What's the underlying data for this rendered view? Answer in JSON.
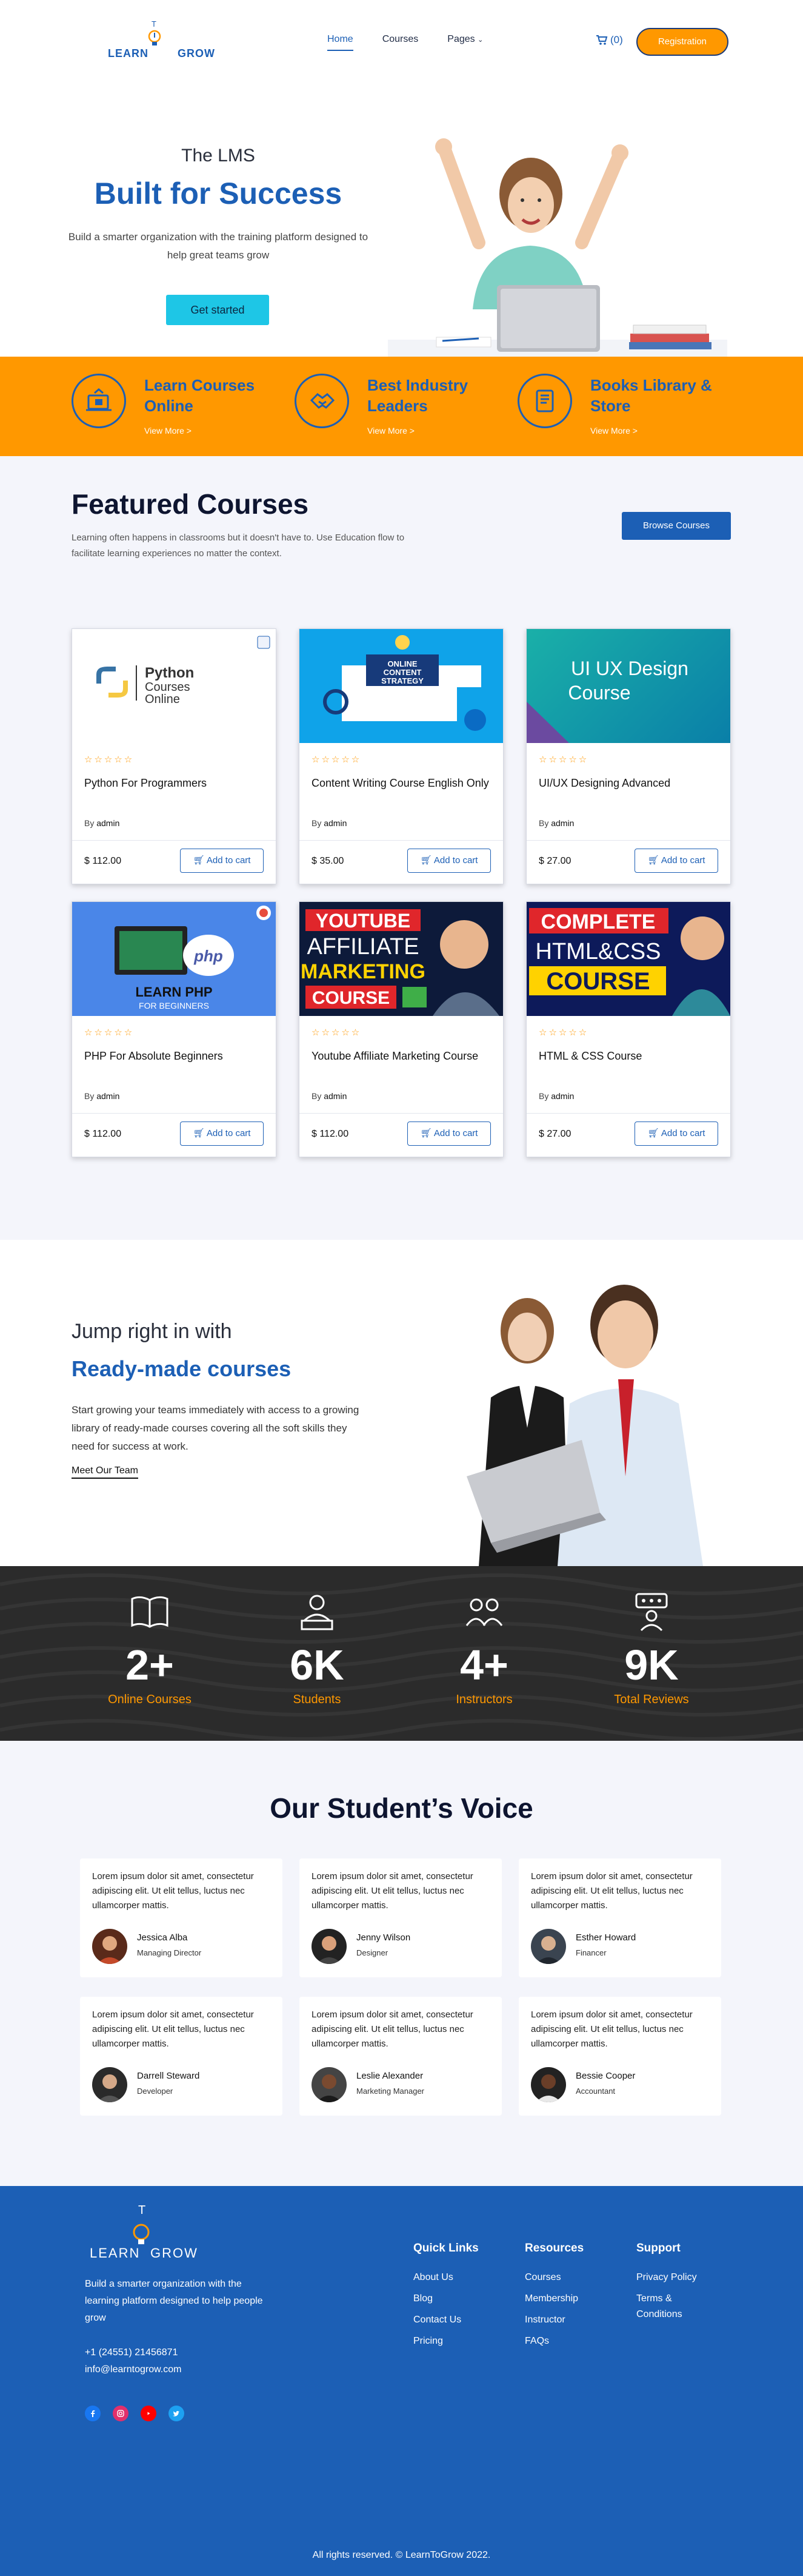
{
  "header": {
    "logo_part1": "LEARN",
    "logo_part2": "GROW",
    "logo_t": "T",
    "nav": [
      "Home",
      "Courses",
      "Pages"
    ],
    "cart_count": "(0)",
    "registration": "Registration"
  },
  "hero": {
    "pre": "The LMS",
    "title": "Built for Success",
    "subtitle": "Build a smarter organization with the training platform designed to help great teams grow",
    "button": "Get started"
  },
  "strip": [
    {
      "title": "Learn Courses Online",
      "more": "View More >"
    },
    {
      "title": "Best Industry Leaders",
      "more": "View More >"
    },
    {
      "title": "Books Library & Store",
      "more": "View More >"
    }
  ],
  "featured": {
    "title": "Featured Courses",
    "subtitle": "Learning often happens in classrooms but it doesn't have to. Use Education flow to facilitate learning experiences no matter the context.",
    "browse": "Browse Courses",
    "by_label": "By",
    "cart_label": "Add to cart",
    "stars": "☆☆☆☆☆",
    "courses": [
      {
        "name": "Python For Programmers",
        "author": "admin",
        "price": "$ 112.00",
        "thumb_lines": [
          "Python",
          "Courses",
          "Online"
        ]
      },
      {
        "name": "Content Writing Course English Only",
        "author": "admin",
        "price": "$ 35.00",
        "thumb_lines": [
          "ONLINE",
          "CONTENT",
          "STRATEGY"
        ]
      },
      {
        "name": "UI/UX Designing Advanced",
        "author": "admin",
        "price": "$ 27.00",
        "thumb_lines": [
          "UI UX Design",
          "Course"
        ]
      },
      {
        "name": "PHP For Absolute Beginners",
        "author": "admin",
        "price": "$ 112.00",
        "thumb_lines": [
          "LEARN PHP",
          "FOR BEGINNERS",
          "php"
        ]
      },
      {
        "name": "Youtube Affiliate Marketing Course",
        "author": "admin",
        "price": "$ 112.00",
        "thumb_lines": [
          "YOUTUBE",
          "AFFILIATE",
          "MARKETING",
          "COURSE"
        ]
      },
      {
        "name": "HTML & CSS Course",
        "author": "admin",
        "price": "$ 27.00",
        "thumb_lines": [
          "COMPLETE",
          "HTML&CSS",
          "COURSE"
        ]
      }
    ]
  },
  "ready": {
    "pre": "Jump right in with",
    "title": "Ready-made courses",
    "text": "Start growing your teams immediately with access to a growing library of ready-made courses covering all the soft skills they need for success at work.",
    "link": "Meet Our Team"
  },
  "stats": [
    {
      "num": "2+",
      "label": "Online Courses",
      "icon": "book-icon"
    },
    {
      "num": "6K",
      "label": "Students",
      "icon": "student-icon"
    },
    {
      "num": "4+",
      "label": "Instructors",
      "icon": "instructors-icon"
    },
    {
      "num": "9K",
      "label": "Total Reviews",
      "icon": "reviews-icon"
    }
  ],
  "voice": {
    "title": "Our Student’s Voice",
    "quote": "Lorem ipsum dolor sit amet, consectetur adipiscing elit. Ut elit tellus, luctus nec ullamcorper mattis.",
    "people": [
      {
        "name": "Jessica Alba",
        "role": "Managing Director"
      },
      {
        "name": "Jenny Wilson",
        "role": "Designer"
      },
      {
        "name": "Esther Howard",
        "role": "Financer"
      },
      {
        "name": "Darrell Steward",
        "role": "Developer"
      },
      {
        "name": "Leslie Alexander",
        "role": "Marketing Manager"
      },
      {
        "name": "Bessie Cooper",
        "role": "Accountant"
      }
    ]
  },
  "footer": {
    "about": "Build a smarter organization with the learning platform designed to help people grow",
    "phone": "+1 (24551) 21456871",
    "email": "info@learntogrow.com",
    "cols": [
      {
        "title": "Quick Links",
        "items": [
          "About Us",
          "Blog",
          "Contact Us",
          "Pricing"
        ]
      },
      {
        "title": "Resources",
        "items": [
          "Courses",
          "Membership",
          "Instructor",
          "FAQs"
        ]
      },
      {
        "title": "Support",
        "items": [
          "Privacy Policy",
          "Terms & Conditions"
        ]
      }
    ],
    "copyright": "All rights reserved. © LearnToGrow 2022.",
    "colors": {
      "brand": "#1c5fb5",
      "accent": "#ff9800"
    }
  }
}
